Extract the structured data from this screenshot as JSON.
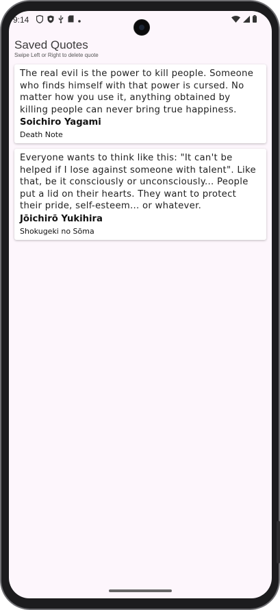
{
  "status_bar": {
    "time": "9:14",
    "left_icons": [
      "shield-outline-icon",
      "shield-check-icon",
      "usb-icon",
      "sim-card-icon",
      "dot-icon"
    ],
    "right_icons": [
      "wifi-icon",
      "signal-icon",
      "battery-icon"
    ]
  },
  "header": {
    "title": "Saved Quotes",
    "subtitle": "Swipe Left or Right to delete quote"
  },
  "quotes": [
    {
      "text": "The real evil is the power to kill people. Someone who finds himself with that power is cursed. No matter how you use it, anything obtained by killing people can never bring true happiness.",
      "author": "Soichiro Yagami",
      "source": "Death Note"
    },
    {
      "text": "Everyone wants to think like this: \"It can't be helped if I lose against someone with talent\". Like that, be it consciously or unconsciously... People put a lid on their hearts. They want to protect their pride, self-esteem... or whatever.",
      "author": "Jōichirō Yukihira",
      "source": "Shokugeki no Sōma"
    }
  ],
  "colors": {
    "screen_background": "#fdf6fc",
    "card_background": "#ffffff"
  }
}
